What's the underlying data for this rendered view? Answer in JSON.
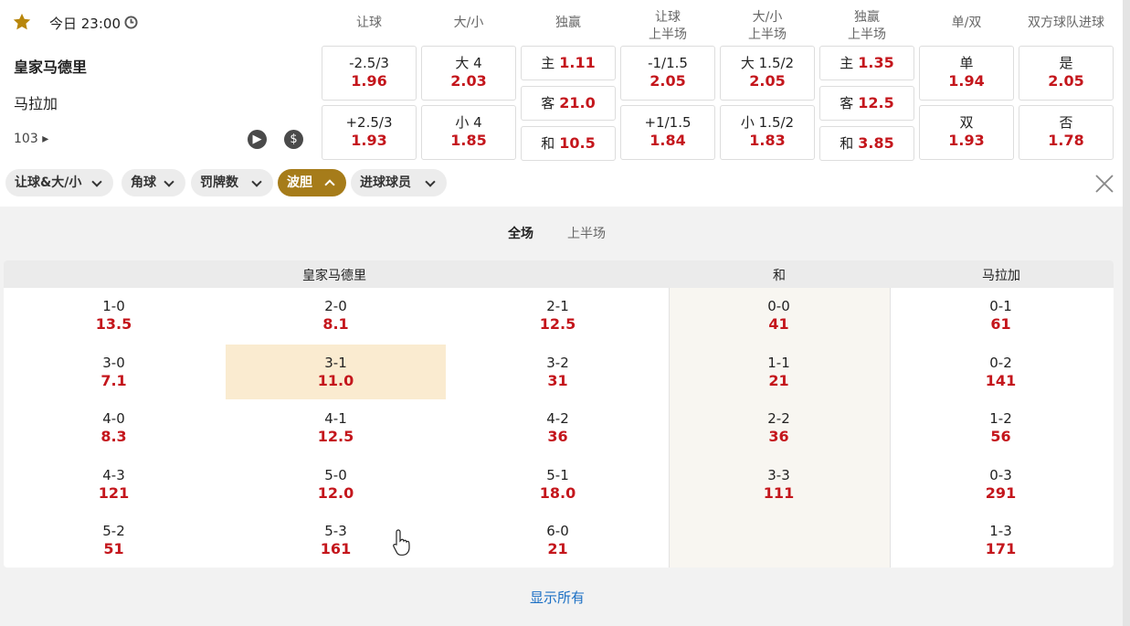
{
  "match": {
    "time": "今日 23:00",
    "home": "皇家马德里",
    "away": "马拉加",
    "more_count": "103"
  },
  "columns": [
    "让球",
    "大/小",
    "独赢",
    "让球\n上半场",
    "大/小\n上半场",
    "独赢\n上半场",
    "单/双",
    "双方球队进球"
  ],
  "markets": {
    "hdp": [
      {
        "label": "-2.5/3",
        "odd": "1.96"
      },
      {
        "label": "+2.5/3",
        "odd": "1.93"
      }
    ],
    "ou": [
      {
        "label": "大 4",
        "odd": "2.03"
      },
      {
        "label": "小 4",
        "odd": "1.85"
      }
    ],
    "ml": [
      {
        "label": "主",
        "odd": "1.11"
      },
      {
        "label": "客",
        "odd": "21.0"
      },
      {
        "label": "和",
        "odd": "10.5"
      }
    ],
    "hdp_1h": [
      {
        "label": "-1/1.5",
        "odd": "2.05"
      },
      {
        "label": "+1/1.5",
        "odd": "1.84"
      }
    ],
    "ou_1h": [
      {
        "label": "大 1.5/2",
        "odd": "2.05"
      },
      {
        "label": "小 1.5/2",
        "odd": "1.83"
      }
    ],
    "ml_1h": [
      {
        "label": "主",
        "odd": "1.35"
      },
      {
        "label": "客",
        "odd": "12.5"
      },
      {
        "label": "和",
        "odd": "3.85"
      }
    ],
    "oe": [
      {
        "label": "单",
        "odd": "1.94"
      },
      {
        "label": "双",
        "odd": "1.93"
      }
    ],
    "btts": [
      {
        "label": "是",
        "odd": "2.05"
      },
      {
        "label": "否",
        "odd": "1.78"
      }
    ]
  },
  "chips": [
    {
      "label": "让球&大/小"
    },
    {
      "label": "角球"
    },
    {
      "label": "罚牌数"
    },
    {
      "label": "波胆",
      "active": true
    },
    {
      "label": "进球球员"
    }
  ],
  "subtabs": {
    "full": "全场",
    "first_half": "上半场"
  },
  "score_table": {
    "headers": {
      "home": "皇家马德里",
      "draw": "和",
      "away": "马拉加"
    },
    "home_col1": [
      {
        "score": "1-0",
        "odd": "13.5"
      },
      {
        "score": "3-0",
        "odd": "7.1"
      },
      {
        "score": "4-0",
        "odd": "8.3"
      },
      {
        "score": "4-3",
        "odd": "121"
      },
      {
        "score": "5-2",
        "odd": "51"
      }
    ],
    "home_col2": [
      {
        "score": "2-0",
        "odd": "8.1"
      },
      {
        "score": "3-1",
        "odd": "11.0",
        "selected": true
      },
      {
        "score": "4-1",
        "odd": "12.5"
      },
      {
        "score": "5-0",
        "odd": "12.0"
      },
      {
        "score": "5-3",
        "odd": "161"
      }
    ],
    "home_col3": [
      {
        "score": "2-1",
        "odd": "12.5"
      },
      {
        "score": "3-2",
        "odd": "31"
      },
      {
        "score": "4-2",
        "odd": "36"
      },
      {
        "score": "5-1",
        "odd": "18.0"
      },
      {
        "score": "6-0",
        "odd": "21"
      }
    ],
    "draw": [
      {
        "score": "0-0",
        "odd": "41"
      },
      {
        "score": "1-1",
        "odd": "21"
      },
      {
        "score": "2-2",
        "odd": "36"
      },
      {
        "score": "3-3",
        "odd": "111"
      }
    ],
    "away": [
      {
        "score": "0-1",
        "odd": "61"
      },
      {
        "score": "0-2",
        "odd": "141"
      },
      {
        "score": "1-2",
        "odd": "56"
      },
      {
        "score": "0-3",
        "odd": "291"
      },
      {
        "score": "1-3",
        "odd": "171"
      }
    ]
  },
  "show_all": "显示所有",
  "colors": {
    "odd": "#c4161c",
    "active_chip": "#a67c1a",
    "selected": "#faebd0",
    "star": "#b8860b",
    "link": "#1a6fc4"
  }
}
